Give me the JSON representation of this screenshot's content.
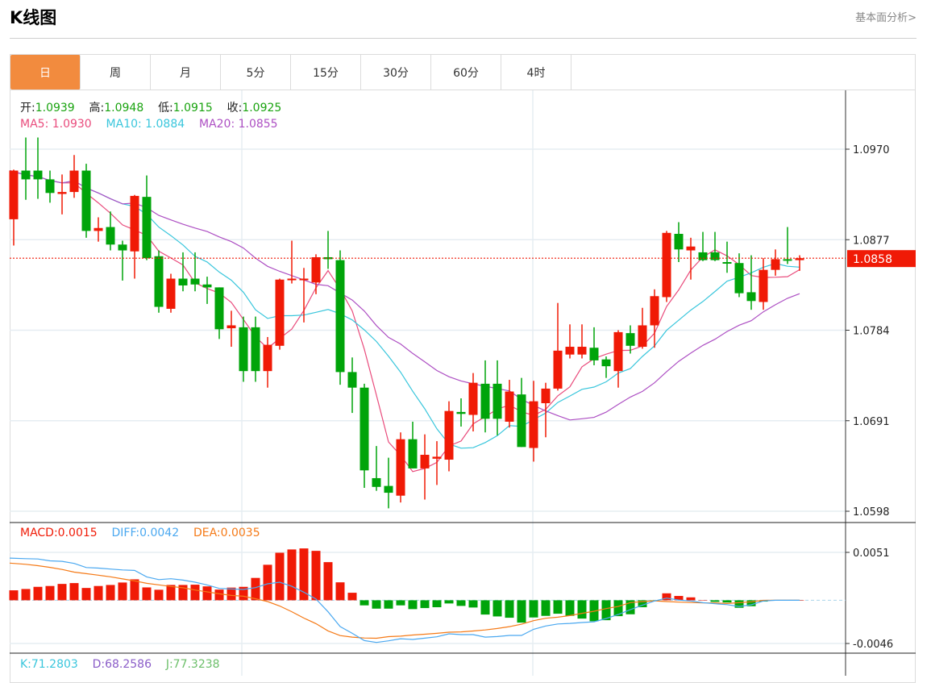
{
  "header": {
    "title": "K线图",
    "more_link": "基本面分析>"
  },
  "tabs": [
    {
      "label": "日",
      "active": true
    },
    {
      "label": "周"
    },
    {
      "label": "月"
    },
    {
      "label": "5分"
    },
    {
      "label": "15分"
    },
    {
      "label": "30分"
    },
    {
      "label": "60分"
    },
    {
      "label": "4时"
    }
  ],
  "ohlc_legend": {
    "open_label": "开:",
    "open": "1.0939",
    "high_label": "高:",
    "high": "1.0948",
    "low_label": "低:",
    "low": "1.0915",
    "close_label": "收:",
    "close": "1.0925"
  },
  "ma_legend": {
    "ma5": "MA5: 1.0930",
    "ma10": "MA10: 1.0884",
    "ma20": "MA20: 1.0855"
  },
  "macd_legend": {
    "macd": "MACD:0.0015",
    "diff": "DIFF:0.0042",
    "dea": "DEA:0.0035"
  },
  "kdj_legend": {
    "k": "K:71.2803",
    "d": "D:68.2586",
    "j": "J:77.3238"
  },
  "colors": {
    "up": "#f01a06",
    "down": "#00a40a",
    "ma5": "#e94b7c",
    "ma10": "#39c6dc",
    "ma20": "#ad4fc3",
    "diff": "#4aa8f0",
    "dea": "#f57a17",
    "accent": "#f28b3e"
  },
  "chart_data": [
    {
      "type": "candlestick",
      "title": "K线图",
      "ylim": [
        1.0598,
        1.097
      ],
      "yticks": [
        "1.0970",
        "1.0877",
        "1.0784",
        "1.0691",
        "1.0598"
      ],
      "last_price": "1.0858",
      "ma_periods": [
        5,
        10,
        20
      ],
      "ohlc": [
        [
          1.0898,
          1.0949,
          1.0871,
          1.0948
        ],
        [
          1.0948,
          1.0982,
          1.0918,
          1.0939
        ],
        [
          1.0948,
          1.0982,
          1.0919,
          1.0939
        ],
        [
          1.0939,
          1.0948,
          1.0915,
          1.0925
        ],
        [
          1.0924,
          1.0944,
          1.0903,
          1.0926
        ],
        [
          1.0926,
          1.0964,
          1.092,
          1.0948
        ],
        [
          1.0948,
          1.0955,
          1.0879,
          1.0886
        ],
        [
          1.0886,
          1.09,
          1.0875,
          1.0889
        ],
        [
          1.089,
          1.0906,
          1.0866,
          1.0872
        ],
        [
          1.0872,
          1.0876,
          1.0835,
          1.0866
        ],
        [
          1.0865,
          1.0923,
          1.0837,
          1.0922
        ],
        [
          1.0921,
          1.0943,
          1.0856,
          1.0858
        ],
        [
          1.086,
          1.0866,
          1.0802,
          1.0808
        ],
        [
          1.0806,
          1.0842,
          1.0802,
          1.0837
        ],
        [
          1.0837,
          1.0864,
          1.0824,
          1.083
        ],
        [
          1.0837,
          1.0864,
          1.0824,
          1.0831
        ],
        [
          1.0831,
          1.0839,
          1.0811,
          1.0828
        ],
        [
          1.0828,
          1.0828,
          1.0775,
          1.0785
        ],
        [
          1.0786,
          1.0804,
          1.0767,
          1.0789
        ],
        [
          1.0787,
          1.0798,
          1.0731,
          1.0742
        ],
        [
          1.0787,
          1.0798,
          1.0731,
          1.0742
        ],
        [
          1.0742,
          1.0777,
          1.0725,
          1.0769
        ],
        [
          1.0768,
          1.0837,
          1.0764,
          1.0836
        ],
        [
          1.0836,
          1.0876,
          1.0832,
          1.0837
        ],
        [
          1.0836,
          1.0848,
          1.0792,
          1.0837
        ],
        [
          1.0833,
          1.0862,
          1.0821,
          1.0859
        ],
        [
          1.0859,
          1.0886,
          1.0847,
          1.0857
        ],
        [
          1.0856,
          1.0866,
          1.0728,
          1.0741
        ],
        [
          1.0741,
          1.0756,
          1.0699,
          1.0725
        ],
        [
          1.0725,
          1.0729,
          1.0622,
          1.064
        ],
        [
          1.0632,
          1.0665,
          1.0619,
          1.0623
        ],
        [
          1.0624,
          1.0653,
          1.0601,
          1.0617
        ],
        [
          1.0614,
          1.0679,
          1.0607,
          1.0672
        ],
        [
          1.0672,
          1.069,
          1.0642,
          1.0642
        ],
        [
          1.0642,
          1.0677,
          1.061,
          1.0656
        ],
        [
          1.0652,
          1.067,
          1.0625,
          1.0654
        ],
        [
          1.0651,
          1.0711,
          1.0639,
          1.0701
        ],
        [
          1.07,
          1.0714,
          1.0685,
          1.0698
        ],
        [
          1.0697,
          1.074,
          1.068,
          1.073
        ],
        [
          1.0729,
          1.0753,
          1.0679,
          1.0693
        ],
        [
          1.0729,
          1.0753,
          1.0676,
          1.0693
        ],
        [
          1.069,
          1.0733,
          1.0684,
          1.0721
        ],
        [
          1.0718,
          1.0735,
          1.0664,
          1.0664
        ],
        [
          1.0663,
          1.0732,
          1.0649,
          1.0711
        ],
        [
          1.0709,
          1.073,
          1.0674,
          1.0724
        ],
        [
          1.0724,
          1.0812,
          1.0722,
          1.0763
        ],
        [
          1.0759,
          1.079,
          1.0755,
          1.0767
        ],
        [
          1.0759,
          1.079,
          1.0755,
          1.0767
        ],
        [
          1.0766,
          1.0787,
          1.0748,
          1.0753
        ],
        [
          1.0754,
          1.0757,
          1.0735,
          1.0747
        ],
        [
          1.0742,
          1.0784,
          1.0725,
          1.0782
        ],
        [
          1.0781,
          1.0789,
          1.076,
          1.0768
        ],
        [
          1.0767,
          1.0807,
          1.0765,
          1.0789
        ],
        [
          1.0789,
          1.0826,
          1.0766,
          1.0819
        ],
        [
          1.0818,
          1.0886,
          1.0813,
          1.0884
        ],
        [
          1.0883,
          1.0895,
          1.0854,
          1.0867
        ],
        [
          1.0866,
          1.0879,
          1.0836,
          1.087
        ],
        [
          1.0864,
          1.0885,
          1.0855,
          1.0856
        ],
        [
          1.0864,
          1.0885,
          1.0855,
          1.0856
        ],
        [
          1.0854,
          1.0875,
          1.0843,
          1.0853
        ],
        [
          1.0853,
          1.0863,
          1.0818,
          1.0822
        ],
        [
          1.0823,
          1.0861,
          1.0805,
          1.0814
        ],
        [
          1.0813,
          1.0858,
          1.0805,
          1.0846
        ],
        [
          1.0846,
          1.0867,
          1.084,
          1.0857
        ],
        [
          1.0857,
          1.089,
          1.0852,
          1.0856
        ],
        [
          1.0856,
          1.0861,
          1.0845,
          1.0858
        ]
      ]
    },
    {
      "type": "bar+line",
      "title": "MACD",
      "ylim": [
        -0.0046,
        0.0051
      ],
      "yticks": [
        "0.0051",
        "-0.0046"
      ],
      "macd": [
        0.00106,
        0.0012,
        0.00143,
        0.00152,
        0.00174,
        0.00183,
        0.00131,
        0.00152,
        0.00163,
        0.00189,
        0.00223,
        0.00137,
        0.00112,
        0.00163,
        0.00163,
        0.00166,
        0.00148,
        0.00114,
        0.00135,
        0.00143,
        0.00238,
        0.00378,
        0.00506,
        0.00541,
        0.00552,
        0.00526,
        0.00406,
        0.00191,
        0.0008,
        -0.00054,
        -0.00089,
        -0.00089,
        -0.00054,
        -0.00094,
        -0.00083,
        -0.00074,
        -0.00034,
        -0.0006,
        -0.00077,
        -0.00152,
        -0.00172,
        -0.00186,
        -0.00238,
        -0.00183,
        -0.00166,
        -0.00143,
        -0.00166,
        -0.00195,
        -0.00223,
        -0.00212,
        -0.00169,
        -0.00149,
        -0.00074,
        -3e-05,
        0.00074,
        0.00046,
        0.00031,
        3e-05,
        -0.00017,
        -0.00023,
        -0.0008,
        -0.00063,
        -0.00014,
        -3e-05,
        0,
        0
      ],
      "diff": [
        0.00449,
        0.00443,
        0.0044,
        0.0042,
        0.00415,
        0.00392,
        0.00349,
        0.00343,
        0.00332,
        0.00323,
        0.00318,
        0.00249,
        0.0022,
        0.00229,
        0.00215,
        0.00192,
        0.00163,
        0.00126,
        0.0012,
        0.00115,
        0.00135,
        0.00175,
        0.00192,
        0.00149,
        0.00086,
        0.00014,
        -0.00123,
        -0.0028,
        -0.00352,
        -0.00429,
        -0.00449,
        -0.00432,
        -0.00409,
        -0.00417,
        -0.00403,
        -0.00389,
        -0.00357,
        -0.00366,
        -0.00366,
        -0.00392,
        -0.00386,
        -0.00374,
        -0.00374,
        -0.00309,
        -0.00274,
        -0.00252,
        -0.00246,
        -0.00237,
        -0.00229,
        -0.00194,
        -0.00151,
        -0.001,
        -0.00051,
        -8e-05,
        0.00023,
        3e-05,
        -8e-05,
        -0.00026,
        -0.00037,
        -0.00046,
        -0.00066,
        -0.00048,
        -8e-05,
        0,
        0,
        0
      ],
      "dea": [
        0.00396,
        0.00383,
        0.00368,
        0.0035,
        0.00328,
        0.003,
        0.00283,
        0.00267,
        0.0025,
        0.00228,
        0.00206,
        0.0018,
        0.00164,
        0.00147,
        0.00133,
        0.00109,
        0.00089,
        0.00069,
        0.00052,
        0.00043,
        0.00016,
        -0.00014,
        -0.00061,
        -0.00122,
        -0.0019,
        -0.00249,
        -0.00326,
        -0.00376,
        -0.00392,
        -0.00402,
        -0.00404,
        -0.00387,
        -0.00382,
        -0.0037,
        -0.00361,
        -0.00352,
        -0.0034,
        -0.00336,
        -0.00327,
        -0.00316,
        -0.003,
        -0.00281,
        -0.00255,
        -0.00217,
        -0.00191,
        -0.0018,
        -0.00163,
        -0.00139,
        -0.00117,
        -0.00088,
        -0.00066,
        -0.00025,
        -0.00014,
        -6e-05,
        -0.00014,
        -0.0002,
        -0.00024,
        -0.00028,
        -0.00028,
        -0.00034,
        -0.00026,
        -0.00016,
        -1e-05,
        0,
        0,
        0
      ]
    }
  ]
}
